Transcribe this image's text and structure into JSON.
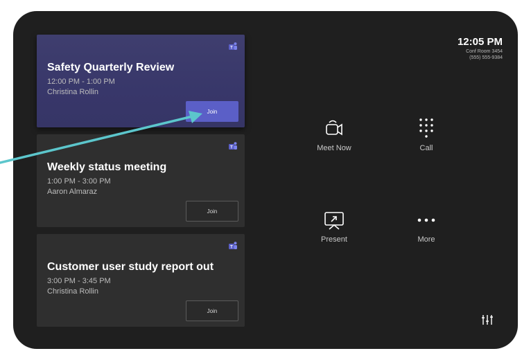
{
  "header": {
    "time": "12:05 PM",
    "room": "Conf Room 3454",
    "phone": "(555) 555-9384"
  },
  "meetings": [
    {
      "title": "Safety Quarterly Review",
      "time": "12:00 PM - 1:00 PM",
      "organizer": "Christina Rollin",
      "join_label": "Join"
    },
    {
      "title": "Weekly status meeting",
      "time": "1:00 PM - 3:00 PM",
      "organizer": "Aaron Almaraz",
      "join_label": "Join"
    },
    {
      "title": "Customer user study report out",
      "time": "3:00 PM - 3:45 PM",
      "organizer": "Christina Rollin",
      "join_label": "Join"
    }
  ],
  "actions": {
    "meet_now": "Meet Now",
    "call": "Call",
    "present": "Present",
    "more": "More"
  },
  "icons": {
    "teams": "teams-icon",
    "meet_now": "video-camera-icon",
    "call": "dialpad-icon",
    "present": "share-screen-icon",
    "more": "ellipsis-icon",
    "settings": "settings-sliders-icon"
  },
  "colors": {
    "accent": "#5b5fc7",
    "annotation_arrow": "#5cc6cc",
    "background": "#1f1f1f"
  }
}
